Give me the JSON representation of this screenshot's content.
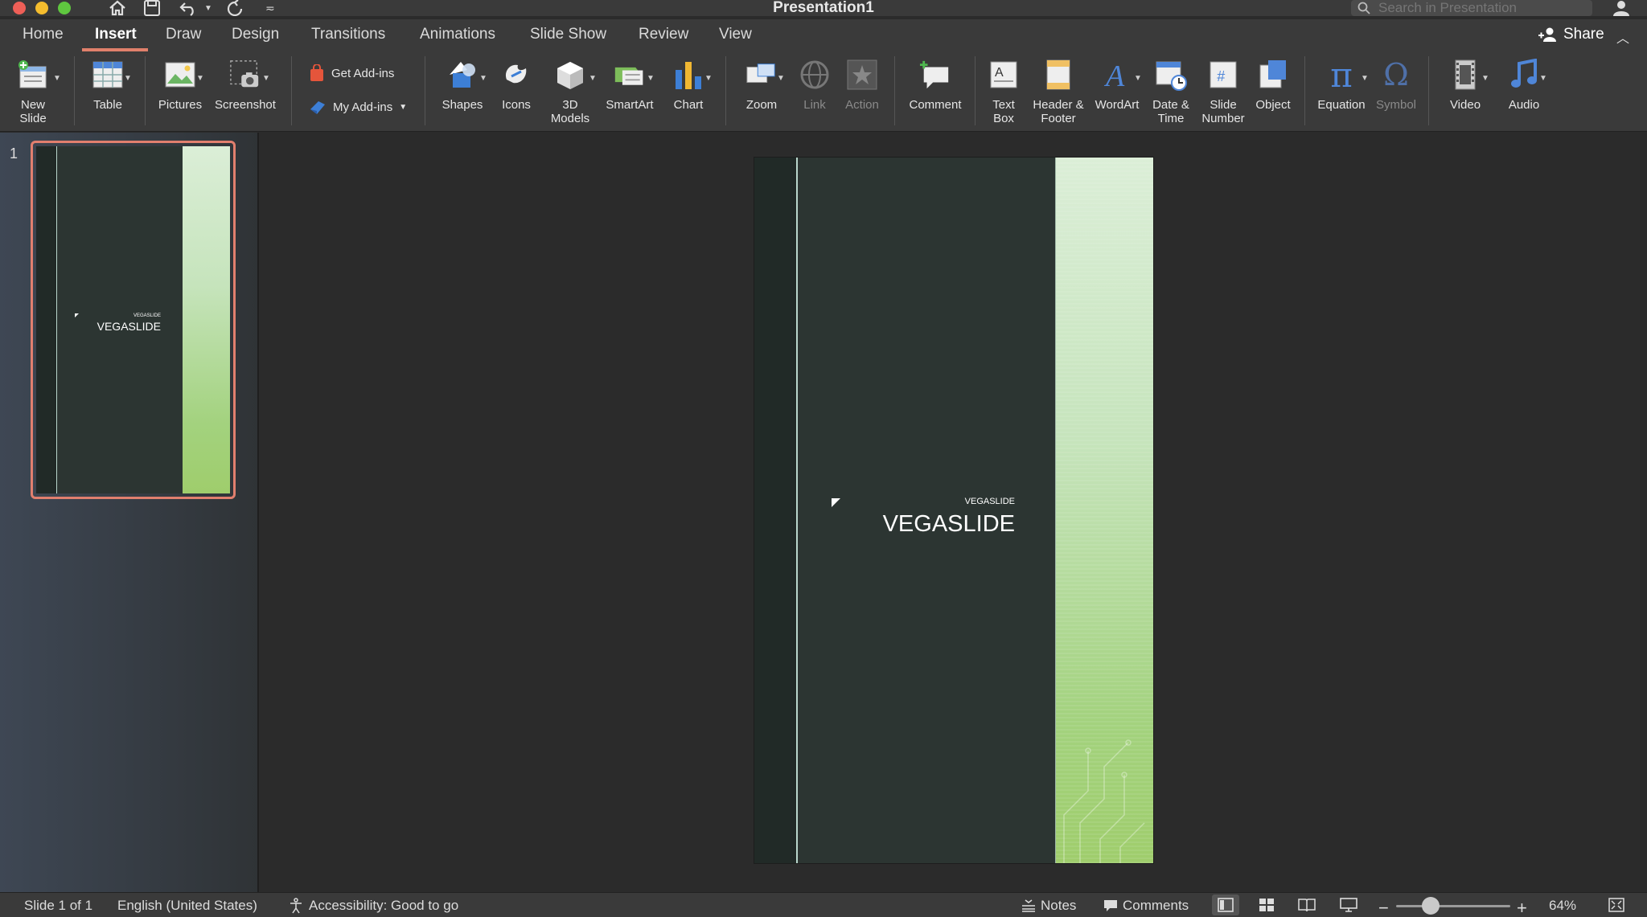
{
  "window": {
    "title": "Presentation1"
  },
  "search": {
    "placeholder": "Search in Presentation"
  },
  "tabs": [
    "Home",
    "Insert",
    "Draw",
    "Design",
    "Transitions",
    "Animations",
    "Slide Show",
    "Review",
    "View"
  ],
  "active_tab": "Insert",
  "share": {
    "label": "Share"
  },
  "ribbon": {
    "new_slide": "New\nSlide",
    "table": "Table",
    "pictures": "Pictures",
    "screenshot": "Screenshot",
    "get_addins": "Get Add-ins",
    "my_addins": "My Add-ins",
    "shapes": "Shapes",
    "icons": "Icons",
    "models_3d": "3D\nModels",
    "smartart": "SmartArt",
    "chart": "Chart",
    "zoom": "Zoom",
    "link": "Link",
    "action": "Action",
    "comment": "Comment",
    "text_box": "Text\nBox",
    "header_footer": "Header &\nFooter",
    "wordart": "WordArt",
    "date_time": "Date &\nTime",
    "slide_number": "Slide\nNumber",
    "object": "Object",
    "equation": "Equation",
    "symbol": "Symbol",
    "video": "Video",
    "audio": "Audio"
  },
  "thumbnails": [
    {
      "number": "1",
      "small_text": "VEGASLIDE",
      "big_text": "VEGASLIDE"
    }
  ],
  "slide": {
    "small_text": "VEGASLIDE",
    "big_text": "VEGASLIDE"
  },
  "status": {
    "slide_info": "Slide 1 of 1",
    "language": "English (United States)",
    "accessibility": "Accessibility: Good to go",
    "notes": "Notes",
    "comments": "Comments",
    "zoom": "64%",
    "zoom_fraction": 0.3
  },
  "colors": {
    "accent": "#e0806b",
    "slide_bg": "#2c3532",
    "green_band": "#a3d27e"
  }
}
